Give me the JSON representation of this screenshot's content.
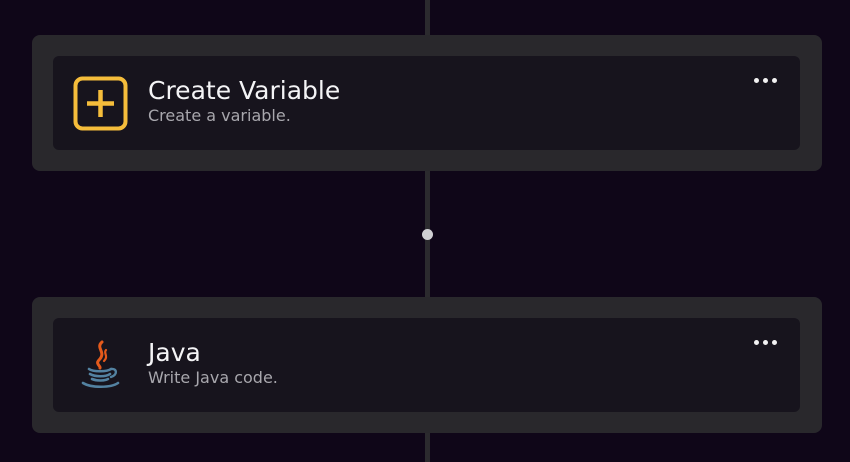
{
  "nodes": [
    {
      "title": "Create Variable",
      "description": "Create a variable.",
      "icon": "plus-square-icon",
      "accent": "#f5bd3b"
    },
    {
      "title": "Java",
      "description": "Write Java code.",
      "icon": "java-icon",
      "accent": "#e76f00"
    }
  ],
  "colors": {
    "background": "#0f0618",
    "node_outer": "#29282c",
    "node_inner": "#17141d",
    "connector": "#2b2a2e"
  }
}
